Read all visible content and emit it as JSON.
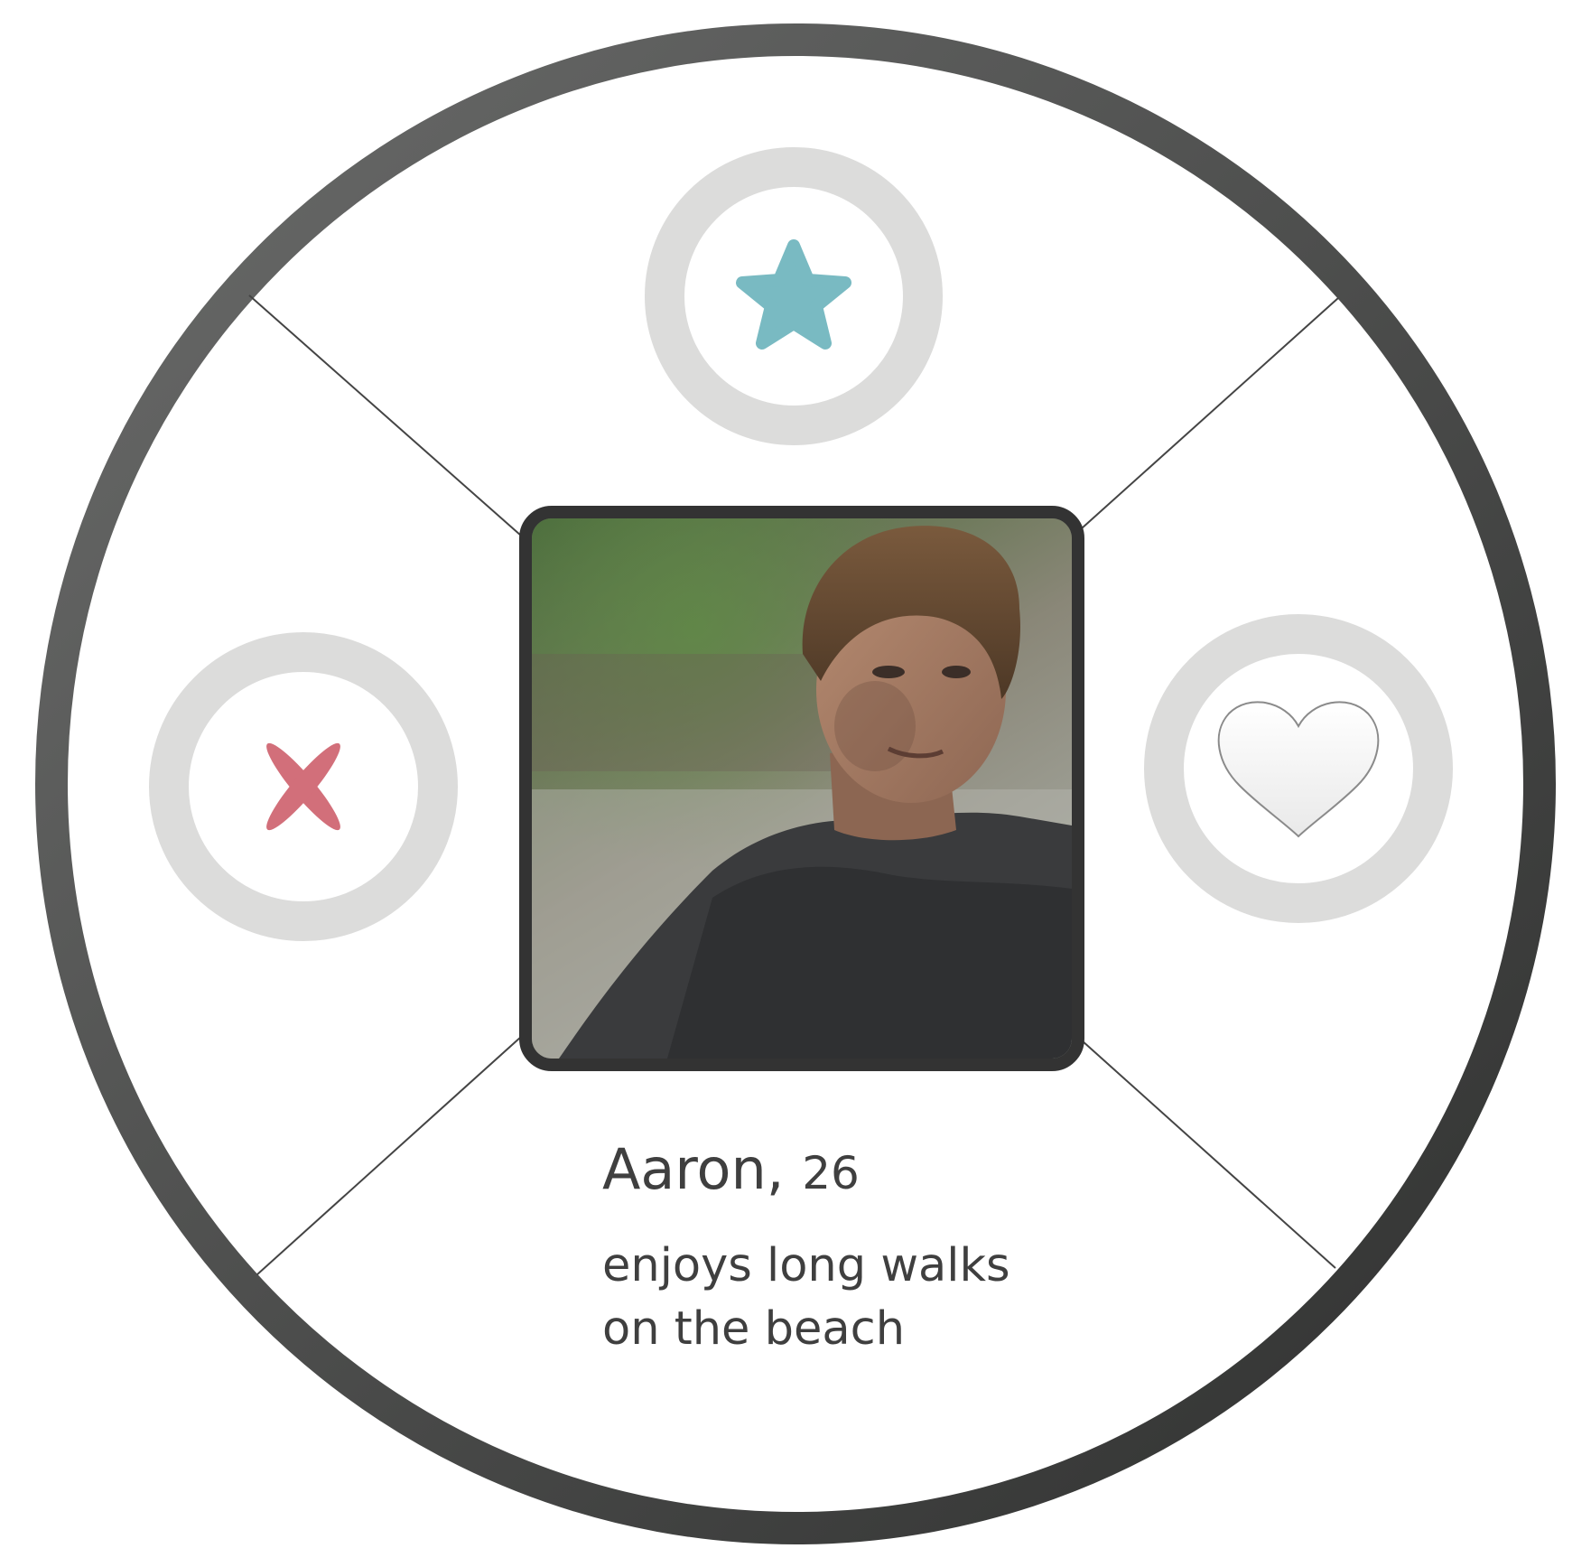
{
  "colors": {
    "ring_outer": "#5a5b5a",
    "ring_fill": "#ffffff",
    "button_ring": "#dcdcdb",
    "star": "#79bac2",
    "nope": "#d26f7a",
    "heart_fill": "#f7f7f7",
    "photo_frame": "#333333",
    "text": "#3f3f3f"
  },
  "actions": {
    "super_like": {
      "icon": "star-icon"
    },
    "nope": {
      "icon": "x-icon"
    },
    "like": {
      "icon": "heart-icon"
    }
  },
  "profile": {
    "name": "Aaron",
    "separator": ",",
    "age": "26",
    "bio_line1": "enjoys long walks",
    "bio_line2": "on the beach",
    "photo": "profile-photo"
  }
}
